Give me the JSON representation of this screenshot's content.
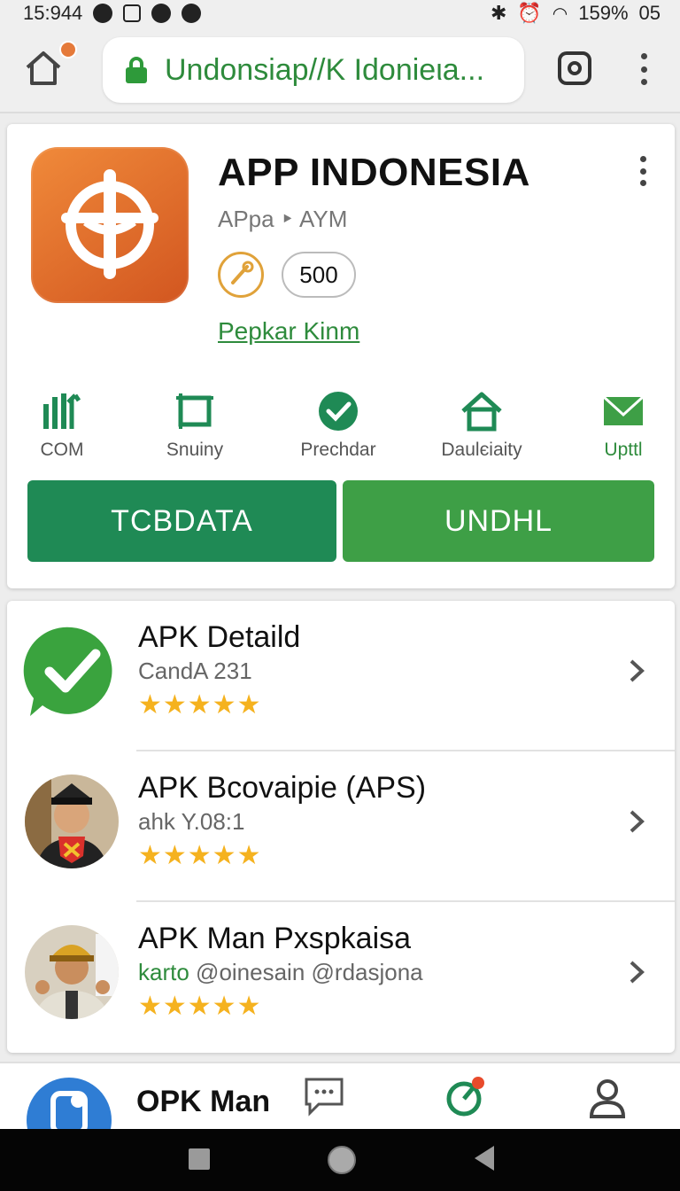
{
  "status_bar": {
    "time": "15:944",
    "battery": "159%",
    "right_number": "05"
  },
  "browser": {
    "url": "Undonsiap//K Idonieιa...",
    "home_icon": "home-icon",
    "lock_icon": "lock-icon",
    "instagram_icon": "instagram-icon",
    "menu_icon": "more-vert-icon"
  },
  "app": {
    "title": "APP INDONESIA",
    "subtitle": "APpa ‣ AYM",
    "rating_count": "500",
    "developer_link": "Pepkar Kinm",
    "accent_color": "#2e8b3c"
  },
  "actions": [
    {
      "label": "COM",
      "icon": "bar-chart-icon"
    },
    {
      "label": "Snuiny",
      "icon": "frame-icon"
    },
    {
      "label": "Prechdar",
      "icon": "check-circle-icon"
    },
    {
      "label": "Daulєiaity",
      "icon": "house-icon"
    },
    {
      "label": "Upttl",
      "icon": "mail-icon"
    }
  ],
  "buttons": {
    "primary_left": "TCBDATA",
    "primary_right": "UNDHL"
  },
  "list": [
    {
      "title": "APK Detaild",
      "subtitle": "CandA 231",
      "rating": 5,
      "avatar": "green-check-chat-icon"
    },
    {
      "title": "APK Bcovaipie (APS)",
      "subtitle": "ahk Y.08:1",
      "rating": 4.5,
      "avatar": "person-avatar"
    },
    {
      "title": "APK Man Pxspkaisa",
      "subtitle_green": "karto",
      "subtitle": "@oinesain @rdasjona",
      "rating": 5,
      "avatar": "person-avatar"
    }
  ],
  "bottom_nav": {
    "app_title": "OPK Man"
  }
}
